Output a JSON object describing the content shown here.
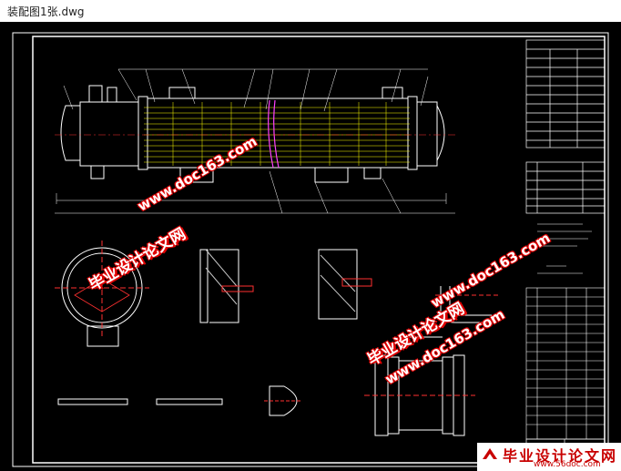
{
  "window": {
    "title": "装配图1张.dwg"
  },
  "watermarks": {
    "chinese": "毕业设计论文网",
    "url_1": "www.doc163.com",
    "url_2": "www.doc163.com",
    "url_3": "www.doc163.com"
  },
  "logo": {
    "text": "毕业设计论文网",
    "url": "www.56doc.com"
  },
  "drawing": {
    "background": "#000000",
    "line_colors": {
      "frame": "#ffffff",
      "tubes": "#ffff00",
      "center": "#ff3030",
      "baffle": "#ff40ff",
      "shell": "#ffffff"
    }
  }
}
